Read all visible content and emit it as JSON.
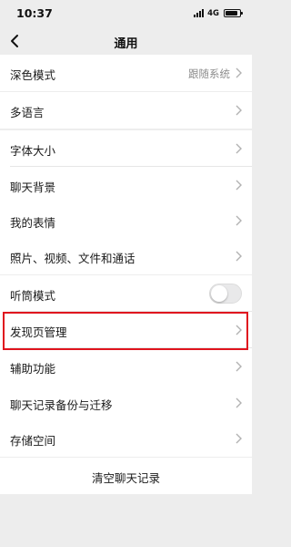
{
  "status": {
    "time": "10:37",
    "network": "4G",
    "battery_level": 0.85
  },
  "nav": {
    "title": "通用",
    "back_icon": "chevron-left-icon"
  },
  "settings": {
    "dark_mode": {
      "label": "深色模式",
      "value": "跟随系统"
    },
    "language": {
      "label": "多语言"
    },
    "font_size": {
      "label": "字体大小"
    },
    "chat_background": {
      "label": "聊天背景"
    },
    "my_stickers": {
      "label": "我的表情"
    },
    "media_files": {
      "label": "照片、视频、文件和通话"
    },
    "earpiece_mode": {
      "label": "听筒模式",
      "enabled": false
    },
    "discover_management": {
      "label": "发现页管理",
      "highlighted": true,
      "highlight_color": "#e0141e"
    },
    "accessibility": {
      "label": "辅助功能"
    },
    "chat_backup": {
      "label": "聊天记录备份与迁移"
    },
    "storage": {
      "label": "存储空间"
    },
    "clear_history": {
      "label": "清空聊天记录"
    }
  }
}
